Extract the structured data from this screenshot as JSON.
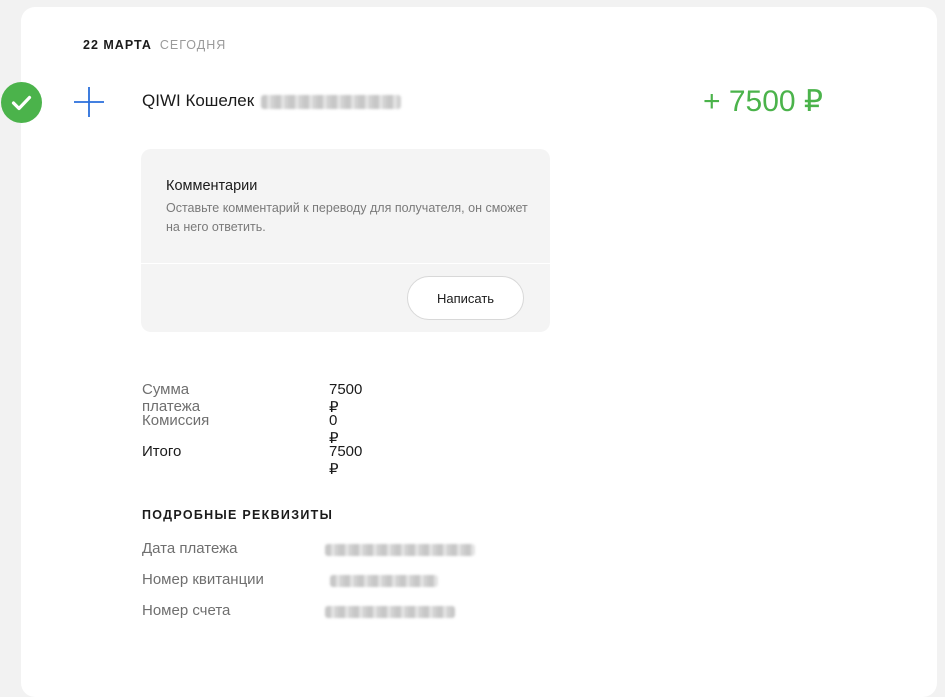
{
  "header": {
    "date": "22 МАРТА",
    "relative": "СЕГОДНЯ"
  },
  "payment": {
    "status_icon": "check-circle-icon",
    "type_icon": "plus-icon",
    "recipient": "QIWI Кошелек",
    "amount": "+ 7500 ₽",
    "colors": {
      "accent_green": "#4bb34b",
      "accent_blue": "#2a6fdb"
    }
  },
  "comments": {
    "title": "Комментарии",
    "description": "Оставьте комментарий к переводу для получателя, он сможет на него ответить.",
    "write_button": "Написать"
  },
  "summary": [
    {
      "label": "Сумма платежа",
      "value": "7500 ₽"
    },
    {
      "label": "Комиссия",
      "value": "0 ₽"
    },
    {
      "label": "Итого",
      "value": "7500 ₽"
    }
  ],
  "details": {
    "title": "ПОДРОБНЫЕ РЕКВИЗИТЫ",
    "rows": [
      {
        "label": "Дата платежа"
      },
      {
        "label": "Номер квитанции"
      },
      {
        "label": "Номер счета"
      }
    ]
  }
}
